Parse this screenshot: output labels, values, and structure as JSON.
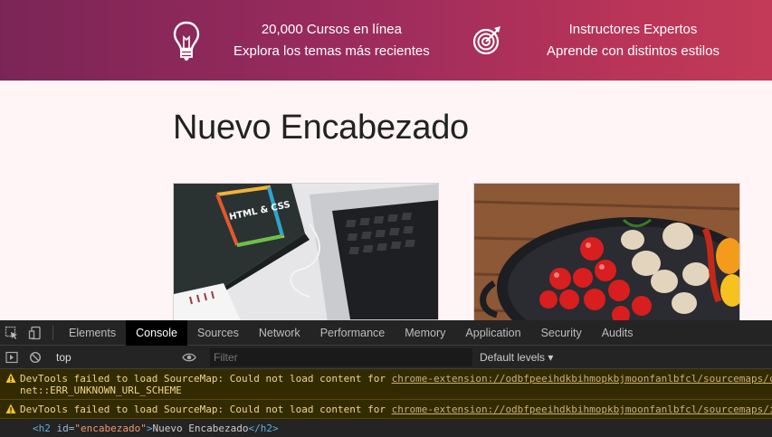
{
  "banner": {
    "feature1": {
      "title": "20,000 Cursos en línea",
      "subtitle": "Explora los temas más recientes",
      "icon": "lightbulb-icon"
    },
    "feature2": {
      "title": "Instructores Expertos",
      "subtitle": "Aprende con distintos estilos",
      "icon": "target-icon"
    },
    "colors": {
      "start": "#7b2556",
      "end": "#c23a57"
    }
  },
  "main": {
    "heading": "Nuevo Encabezado",
    "cards": [
      {
        "name": "course-card-html-css",
        "image_text": "HTML & CSS"
      },
      {
        "name": "course-card-cooking"
      }
    ]
  },
  "devtools": {
    "tabs": [
      "Elements",
      "Console",
      "Sources",
      "Network",
      "Performance",
      "Memory",
      "Application",
      "Security",
      "Audits"
    ],
    "active_tab": "Console",
    "context": "top",
    "filter_placeholder": "Filter",
    "levels": "Default levels ▾",
    "messages": [
      {
        "prefix": "DevTools failed to load SourceMap: Could not load content for ",
        "link": "chrome-extension://odbfpeeihdkbihmopkbjmoonfanlbfcl/sourcemaps/c",
        "detail": "net::ERR_UNKNOWN_URL_SCHEME"
      },
      {
        "prefix": "DevTools failed to load SourceMap: Could not load content for ",
        "link": "chrome-extension://odbfpeeihdkbihmopkbjmoonfanlbfcl/sourcemaps/i"
      }
    ],
    "element_output": {
      "open_tag": "<h2",
      "attr_name": " id=",
      "attr_value": "\"encabezado\"",
      "close_open": ">",
      "text": "Nuevo Encabezado",
      "close_tag": "</h2>"
    }
  }
}
